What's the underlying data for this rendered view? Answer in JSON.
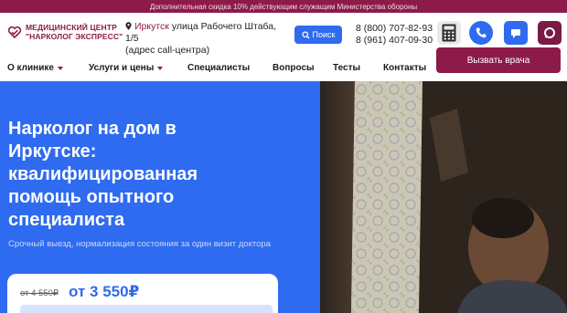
{
  "promo": {
    "text": "Дополнительная скидка 10% действующим служащим Министерства обороны"
  },
  "logo": {
    "line1": "МЕДИЦИНСКИЙ ЦЕНТР",
    "line2": "\"НАРКОЛОГ ЭКСПРЕСС\""
  },
  "address": {
    "city": "Иркутск",
    "street": "улица Рабочего Штаба,",
    "building": "1/5",
    "note": "(адрес call-центра)"
  },
  "search": {
    "label": "Поиск"
  },
  "phones": [
    "8 (800) 707-82-93",
    "8 (961) 407-09-30"
  ],
  "header_icons": [
    "calculator-icon",
    "phone-icon",
    "chat-icon",
    "max-messenger-icon"
  ],
  "nav": {
    "items": [
      {
        "label": "О клинике",
        "dropdown": true
      },
      {
        "label": "Услуги и цены",
        "dropdown": true
      },
      {
        "label": "Специалисты",
        "dropdown": false
      },
      {
        "label": "Вопросы",
        "dropdown": false
      },
      {
        "label": "Тесты",
        "dropdown": false
      },
      {
        "label": "Контакты",
        "dropdown": false
      }
    ]
  },
  "cta": {
    "label": "Вызвать врача"
  },
  "hero": {
    "title": "Нарколог на дом в Иркутске: квалифицированная помощь опытного специалиста",
    "subtitle": "Срочный выезд, нормализация состояния за один визит доктора",
    "old_price": "от 4 550₽",
    "new_price": "от 3 550₽"
  },
  "colors": {
    "brand": "#8d1b4a",
    "accent_blue": "#2f6bf0",
    "hero_background": "#2f6bf0"
  }
}
